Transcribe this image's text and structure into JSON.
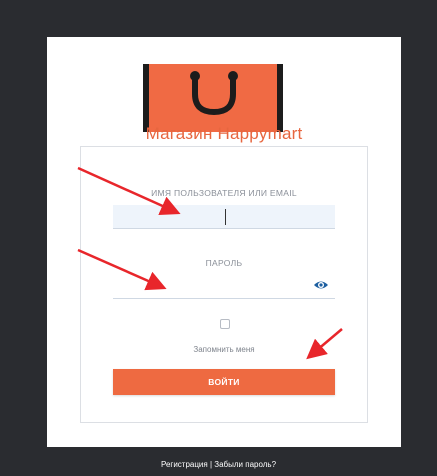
{
  "brand": {
    "name": "Магазин Happymart"
  },
  "form": {
    "username_label": "ИМЯ ПОЛЬЗОВАТЕЛЯ ИЛИ EMAIL",
    "username_value": "",
    "password_label": "ПАРОЛЬ",
    "password_value": "",
    "remember_label": "Запомнить меня",
    "remember_checked": false,
    "submit_label": "ВОЙТИ"
  },
  "footer": {
    "register_label": "Регистрация",
    "separator": " | ",
    "forgot_label": "Забыли пароль?"
  },
  "colors": {
    "accent": "#ee6a41",
    "background": "#2a2c30",
    "arrow": "#e8262b"
  },
  "icons": {
    "logo": "shopping-bag-icon",
    "eye": "eye-icon"
  }
}
